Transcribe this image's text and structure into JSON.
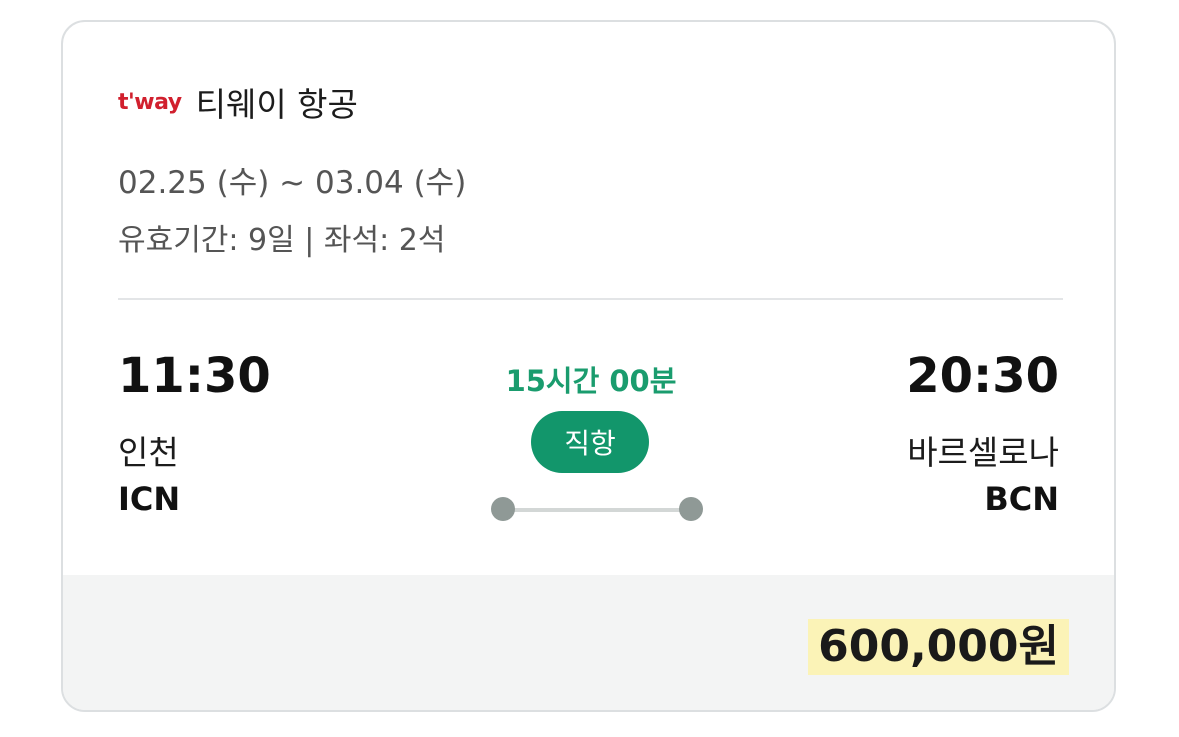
{
  "airline": {
    "logo_text": "t'way",
    "name": "티웨이 항공"
  },
  "trip": {
    "dates": "02.25 (수) ~ 03.04 (수)",
    "meta": "유효기간: 9일 | 좌석: 2석"
  },
  "departure": {
    "time": "11:30",
    "city": "인천",
    "code": "ICN"
  },
  "arrival": {
    "time": "20:30",
    "city": "바르셀로나",
    "code": "BCN"
  },
  "flight": {
    "duration": "15시간 00분",
    "type": "직항"
  },
  "price": "600,000원",
  "colors": {
    "brand_red": "#d1202e",
    "accent_green": "#12966b",
    "duration_green": "#1a9c6e",
    "price_highlight": "#fbf3b7"
  }
}
